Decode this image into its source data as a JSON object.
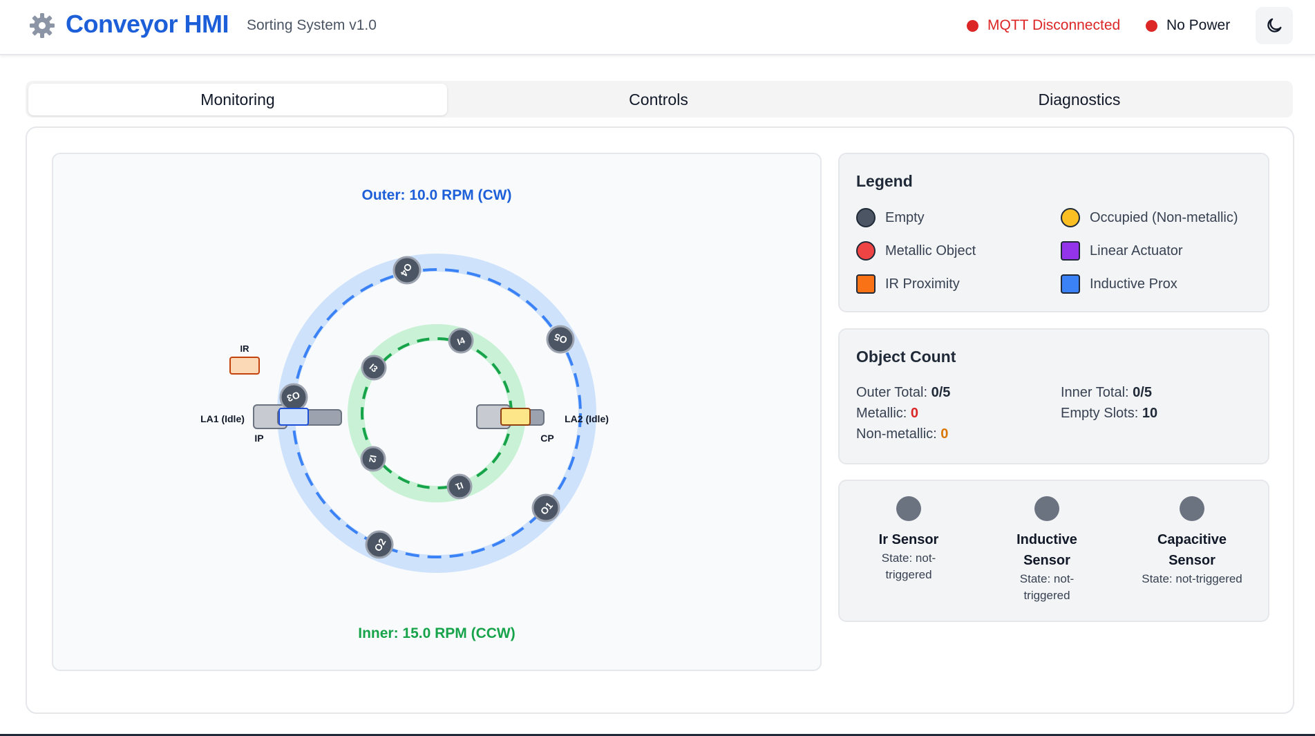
{
  "header": {
    "logo_icon": "gear-icon",
    "title": "Conveyor HMI",
    "subtitle": "Sorting System v1.0",
    "mqtt_status": "MQTT Disconnected",
    "power_status": "No Power",
    "theme_icon": "moon-icon"
  },
  "colors": {
    "brand": "#1d5fd8",
    "error": "#dc2626",
    "outer_track": "#3b82f6",
    "inner_track": "#16a34a",
    "empty": "#4b5563",
    "occupied": "#fbbf24",
    "metallic": "#ef4444",
    "actuator": "#9333ea",
    "ir": "#f97316",
    "inductive": "#3b82f6"
  },
  "tabs": [
    {
      "label": "Monitoring",
      "active": true
    },
    {
      "label": "Controls",
      "active": false
    },
    {
      "label": "Diagnostics",
      "active": false
    }
  ],
  "diagram": {
    "outer_rpm": "Outer: 10.0 RPM (CW)",
    "inner_rpm": "Inner: 15.0 RPM (CCW)",
    "la1_label": "LA1 (Idle)",
    "la2_label": "LA2 (Idle)",
    "ir_label": "IR",
    "ip_label": "IP",
    "cp_label": "CP",
    "outer_slots": [
      "O1",
      "O2",
      "O3",
      "O4",
      "O5"
    ],
    "inner_slots": [
      "I1",
      "I2",
      "I3",
      "I4"
    ]
  },
  "legend": {
    "title": "Legend",
    "items": [
      {
        "label": "Empty",
        "shape": "circle",
        "color": "#4b5563"
      },
      {
        "label": "Occupied (Non-metallic)",
        "shape": "circle",
        "color": "#fbbf24"
      },
      {
        "label": "Metallic Object",
        "shape": "circle",
        "color": "#ef4444"
      },
      {
        "label": "Linear Actuator",
        "shape": "square",
        "color": "#9333ea"
      },
      {
        "label": "IR Proximity",
        "shape": "square",
        "color": "#f97316"
      },
      {
        "label": "Inductive Prox",
        "shape": "square",
        "color": "#3b82f6"
      }
    ]
  },
  "object_count": {
    "title": "Object Count",
    "outer_total_label": "Outer Total:",
    "outer_total": "0/5",
    "inner_total_label": "Inner Total:",
    "inner_total": "0/5",
    "metallic_label": "Metallic:",
    "metallic": "0",
    "empty_slots_label": "Empty Slots:",
    "empty_slots": "10",
    "non_metallic_label": "Non-metallic:",
    "non_metallic": "0"
  },
  "sensors": [
    {
      "name": "Ir Sensor",
      "state": "State: not-triggered"
    },
    {
      "name": "Inductive Sensor",
      "state": "State: not-triggered"
    },
    {
      "name": "Capacitive Sensor",
      "state": "State: not-triggered"
    }
  ]
}
